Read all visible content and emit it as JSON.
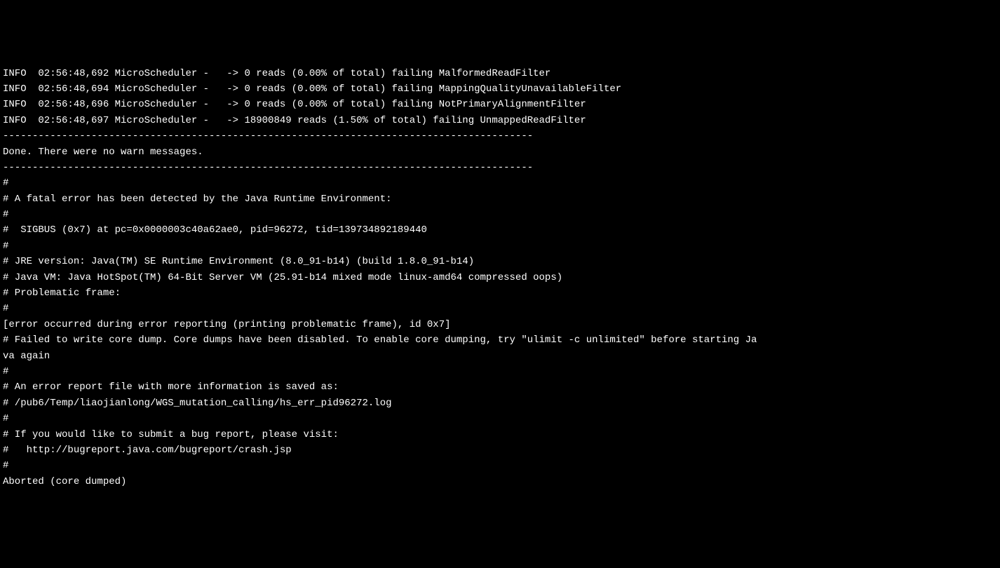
{
  "lines": [
    "INFO  02:56:48,692 MicroScheduler -   -> 0 reads (0.00% of total) failing MalformedReadFilter ",
    "INFO  02:56:48,694 MicroScheduler -   -> 0 reads (0.00% of total) failing MappingQualityUnavailableFilter ",
    "INFO  02:56:48,696 MicroScheduler -   -> 0 reads (0.00% of total) failing NotPrimaryAlignmentFilter ",
    "INFO  02:56:48,697 MicroScheduler -   -> 18900849 reads (1.50% of total) failing UnmappedReadFilter ",
    "------------------------------------------------------------------------------------------",
    "Done. There were no warn messages.",
    "------------------------------------------------------------------------------------------",
    "#",
    "# A fatal error has been detected by the Java Runtime Environment:",
    "#",
    "#  SIGBUS (0x7) at pc=0x0000003c40a62ae0, pid=96272, tid=139734892189440",
    "#",
    "# JRE version: Java(TM) SE Runtime Environment (8.0_91-b14) (build 1.8.0_91-b14)",
    "# Java VM: Java HotSpot(TM) 64-Bit Server VM (25.91-b14 mixed mode linux-amd64 compressed oops)",
    "# Problematic frame:",
    "# ",
    "[error occurred during error reporting (printing problematic frame), id 0x7]",
    "",
    "# Failed to write core dump. Core dumps have been disabled. To enable core dumping, try \"ulimit -c unlimited\" before starting Ja",
    "va again",
    "#",
    "# An error report file with more information is saved as:",
    "# /pub6/Temp/liaojianlong/WGS_mutation_calling/hs_err_pid96272.log",
    "#",
    "# If you would like to submit a bug report, please visit:",
    "#   http://bugreport.java.com/bugreport/crash.jsp",
    "#",
    "Aborted (core dumped)"
  ]
}
